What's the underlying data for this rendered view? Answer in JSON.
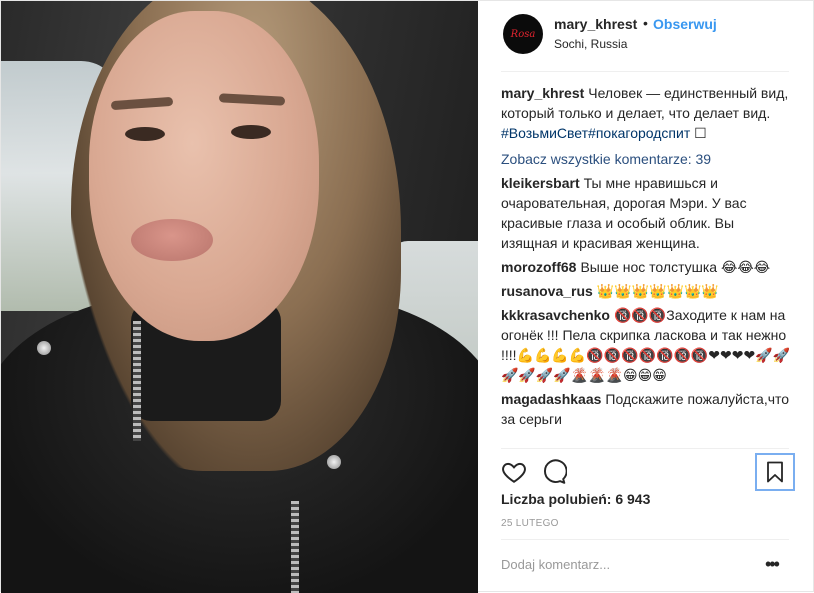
{
  "header": {
    "username": "mary_khrest",
    "separator": "•",
    "follow_label": "Obserwuj",
    "location": "Sochi, Russia",
    "avatar_text": "Rosa"
  },
  "caption": {
    "username": "mary_khrest",
    "text": "Человек — единственный вид, который только и делает, что делает вид. ",
    "hashtags": "#ВозьмиСвет#покагородспит",
    "trailing_icon": "☐"
  },
  "view_all_comments": "Zobacz wszystkie komentarze: 39",
  "comments": [
    {
      "username": "kleikersbart",
      "text": "Ты мне нравишься и очаровательная, дорогая Мэри. У вас красивые глаза и особый облик. Вы изящная и красивая женщина."
    },
    {
      "username": "morozoff68",
      "text": "Выше нос толстушка 😂😂😂"
    },
    {
      "username": "rusanova_rus",
      "text": "👑👑👑👑👑👑👑"
    },
    {
      "username": "kkkrasavchenko",
      "text": "🔞🔞🔞Заходите к нам на огонёк !!! Пела скрипка ласкова и так нежно !!!!💪💪💪💪🔞🔞🔞🔞🔞🔞🔞❤❤❤❤🚀🚀🚀🚀🚀🚀🌋🌋🌋😁😁😁"
    },
    {
      "username": "magadashkaas",
      "text": "Подскажите пожалуйста,что за серьги"
    }
  ],
  "likes_label": "Liczba polubień: 6 943",
  "date": "25 LUTEGO",
  "add_comment_placeholder": "Dodaj komentarz...",
  "more_options": "•••"
}
